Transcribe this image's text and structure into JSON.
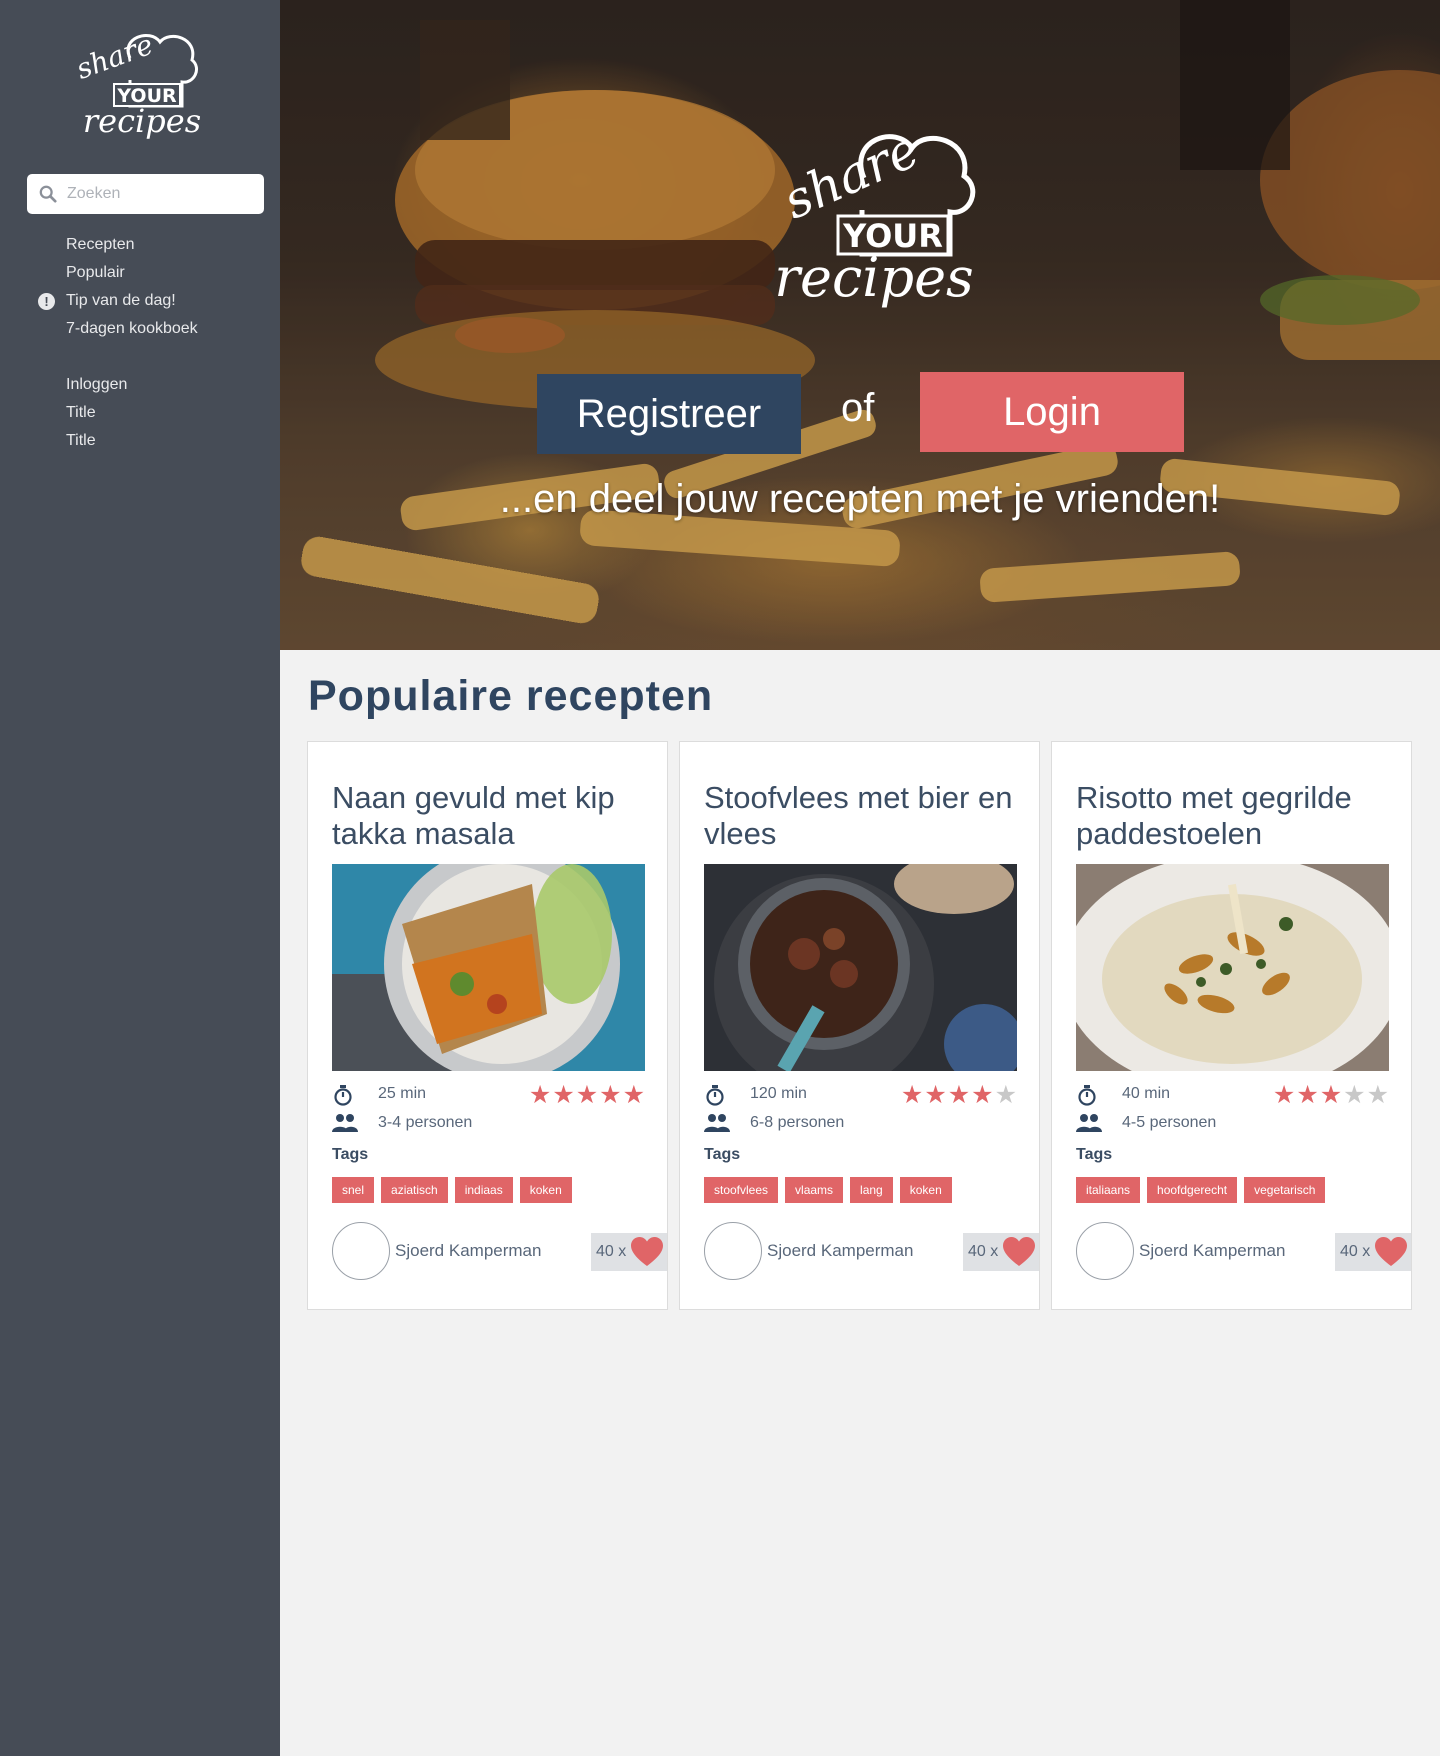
{
  "sidebar": {
    "logo_text": {
      "top": "share",
      "middle": "YOUR",
      "bottom": "recipes"
    },
    "search": {
      "placeholder": "Zoeken",
      "icon": "search-icon"
    },
    "nav": [
      {
        "label": "Recepten"
      },
      {
        "label": "Populair"
      },
      {
        "label": "Tip van de dag!",
        "icon": "alert-icon"
      },
      {
        "label": "7-dagen kookboek"
      },
      {
        "label": "Inloggen"
      },
      {
        "label": "Title"
      },
      {
        "label": "Title"
      }
    ]
  },
  "hero": {
    "logo_text": {
      "top": "share",
      "middle": "YOUR",
      "bottom": "recipes"
    },
    "register_label": "Registreer",
    "or_text": "of",
    "login_label": "Login",
    "tagline": "...en deel jouw recepten met je vrienden!"
  },
  "section": {
    "title": "Populaire recepten"
  },
  "cards": [
    {
      "title": "Naan gevuld met kip takka masala",
      "time": "25 min",
      "people": "3-4 personen",
      "rating": 5,
      "tags_label": "Tags",
      "tags": [
        "snel",
        "aziatisch",
        "indiaas",
        "koken"
      ],
      "author": "Sjoerd Kamperman",
      "likes": "40 x"
    },
    {
      "title": "Stoofvlees met bier en vlees",
      "time": "120 min",
      "people": "6-8 personen",
      "rating": 4,
      "tags_label": "Tags",
      "tags": [
        "stoofvlees",
        "vlaams",
        "lang",
        "koken"
      ],
      "author": "Sjoerd Kamperman",
      "likes": "40 x"
    },
    {
      "title": "Risotto met gegrilde paddestoelen",
      "time": "40 min",
      "people": "4-5 personen",
      "rating": 3,
      "tags_label": "Tags",
      "tags": [
        "italiaans",
        "hoofdgerecht",
        "vegetarisch"
      ],
      "author": "Sjoerd Kamperman",
      "likes": "40 x"
    }
  ],
  "colors": {
    "sidebar_bg": "#464c56",
    "navy": "#2f4560",
    "accent": "#e06567",
    "page_bg": "#f2f2f2"
  }
}
